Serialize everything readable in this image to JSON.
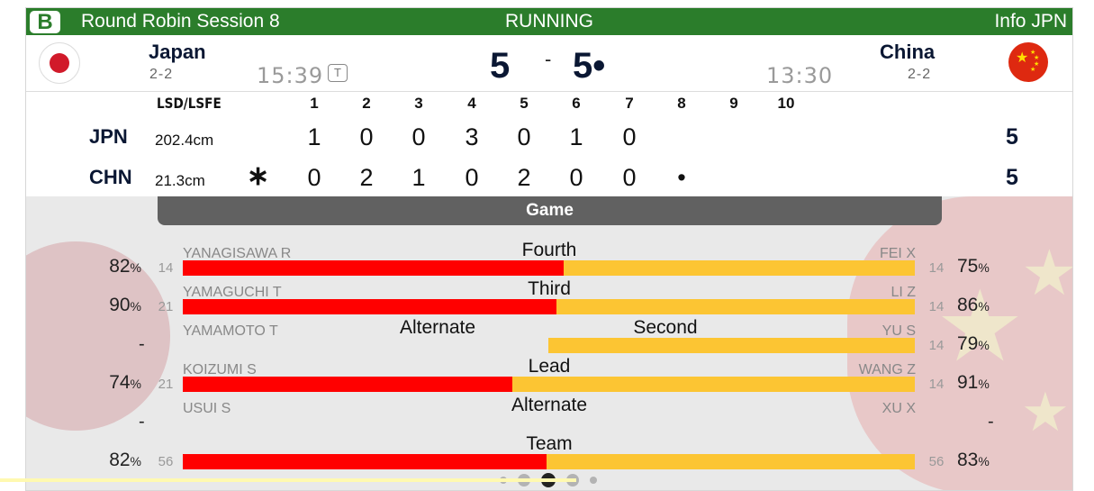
{
  "header": {
    "sheet": "B",
    "session": "Round Robin Session 8",
    "status": "RUNNING",
    "info": "Info JPN"
  },
  "scoreboard": {
    "left": {
      "name": "Japan",
      "record": "2-2",
      "clock": "15:39",
      "score": "5",
      "flag": "japan-flag-icon"
    },
    "right": {
      "name": "China",
      "record": "2-2",
      "clock": "13:30",
      "score": "5•",
      "flag": "china-flag-icon"
    },
    "separator": "-",
    "timeout_badge": "T"
  },
  "linescore": {
    "lsd_header": "LSD/LSFE",
    "ends": [
      "1",
      "2",
      "3",
      "4",
      "5",
      "6",
      "7",
      "8",
      "9",
      "10"
    ],
    "rows": [
      {
        "abbr": "JPN",
        "lsd": "202.4cm",
        "hammer": "",
        "ends": [
          "1",
          "0",
          "0",
          "3",
          "0",
          "1",
          "0",
          "",
          "",
          ""
        ],
        "total": "5"
      },
      {
        "abbr": "CHN",
        "lsd": "21.3cm",
        "hammer": "∗",
        "ends": [
          "0",
          "2",
          "1",
          "0",
          "2",
          "0",
          "0",
          "•",
          "",
          ""
        ],
        "total": "5"
      }
    ]
  },
  "game": {
    "tab_label": "Game",
    "positions": [
      {
        "label": "Fourth",
        "left_player": "YANAGISAWA R",
        "right_player": "FEI X",
        "left_pct": "82",
        "left_shots": "14",
        "right_pct": "75",
        "right_shots": "14",
        "left_share": 0.52
      },
      {
        "label": "Third",
        "left_player": "YAMAGUCHI T",
        "right_player": "LI Z",
        "left_pct": "90",
        "left_shots": "21",
        "right_pct": "86",
        "right_shots": "14",
        "left_share": 0.51
      },
      {
        "label": "Second",
        "left_label": "Alternate",
        "left_player": "YAMAMOTO T",
        "right_player": "YU S",
        "left_pct": "-",
        "left_shots": "",
        "right_pct": "79",
        "right_shots": "14",
        "left_share": 0
      },
      {
        "label": "Lead",
        "left_player": "KOIZUMI S",
        "right_player": "WANG Z",
        "left_pct": "74",
        "left_shots": "21",
        "right_pct": "91",
        "right_shots": "14",
        "left_share": 0.45
      },
      {
        "label": "Alternate",
        "left_player": "USUI S",
        "right_player": "XU X",
        "left_pct": "-",
        "left_shots": "",
        "right_pct": "-",
        "right_shots": "",
        "left_share": null
      },
      {
        "label": "Team",
        "left_player": "",
        "right_player": "",
        "left_pct": "82",
        "left_shots": "56",
        "right_pct": "83",
        "right_shots": "56",
        "left_share": 0.497
      }
    ],
    "percent_sign": "%",
    "colors": {
      "left": "#ff0000",
      "right": "#fcc533",
      "header": "#2b7d2b",
      "tab": "#616161"
    }
  },
  "pager": {
    "pages": 5,
    "active": 3
  }
}
